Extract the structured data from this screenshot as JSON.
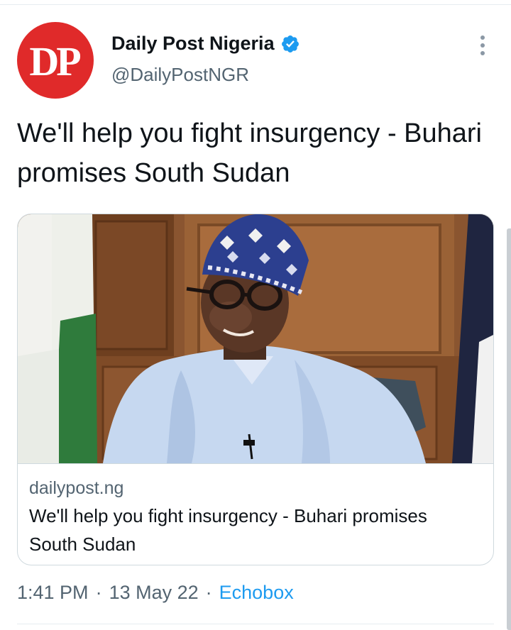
{
  "author": {
    "avatar_text": "DP",
    "display_name": "Daily Post Nigeria",
    "handle": "@DailyPostNGR",
    "verified": true,
    "avatar_color": "#e02a2a"
  },
  "tweet": {
    "text": "We'll help you fight insurgency - Buhari promises South Sudan"
  },
  "link_card": {
    "domain": "dailypost.ng",
    "title": "We'll help you fight insurgency - Buhari promises South Sudan"
  },
  "meta": {
    "time": "1:41 PM",
    "separator": "·",
    "date": "13 May 22",
    "source": "Echobox"
  },
  "colors": {
    "accent": "#1d9bf0",
    "secondary_text": "#536471",
    "primary_text": "#0f1419"
  },
  "icons": {
    "verified": "verified-badge-icon",
    "more": "more-options-icon"
  }
}
